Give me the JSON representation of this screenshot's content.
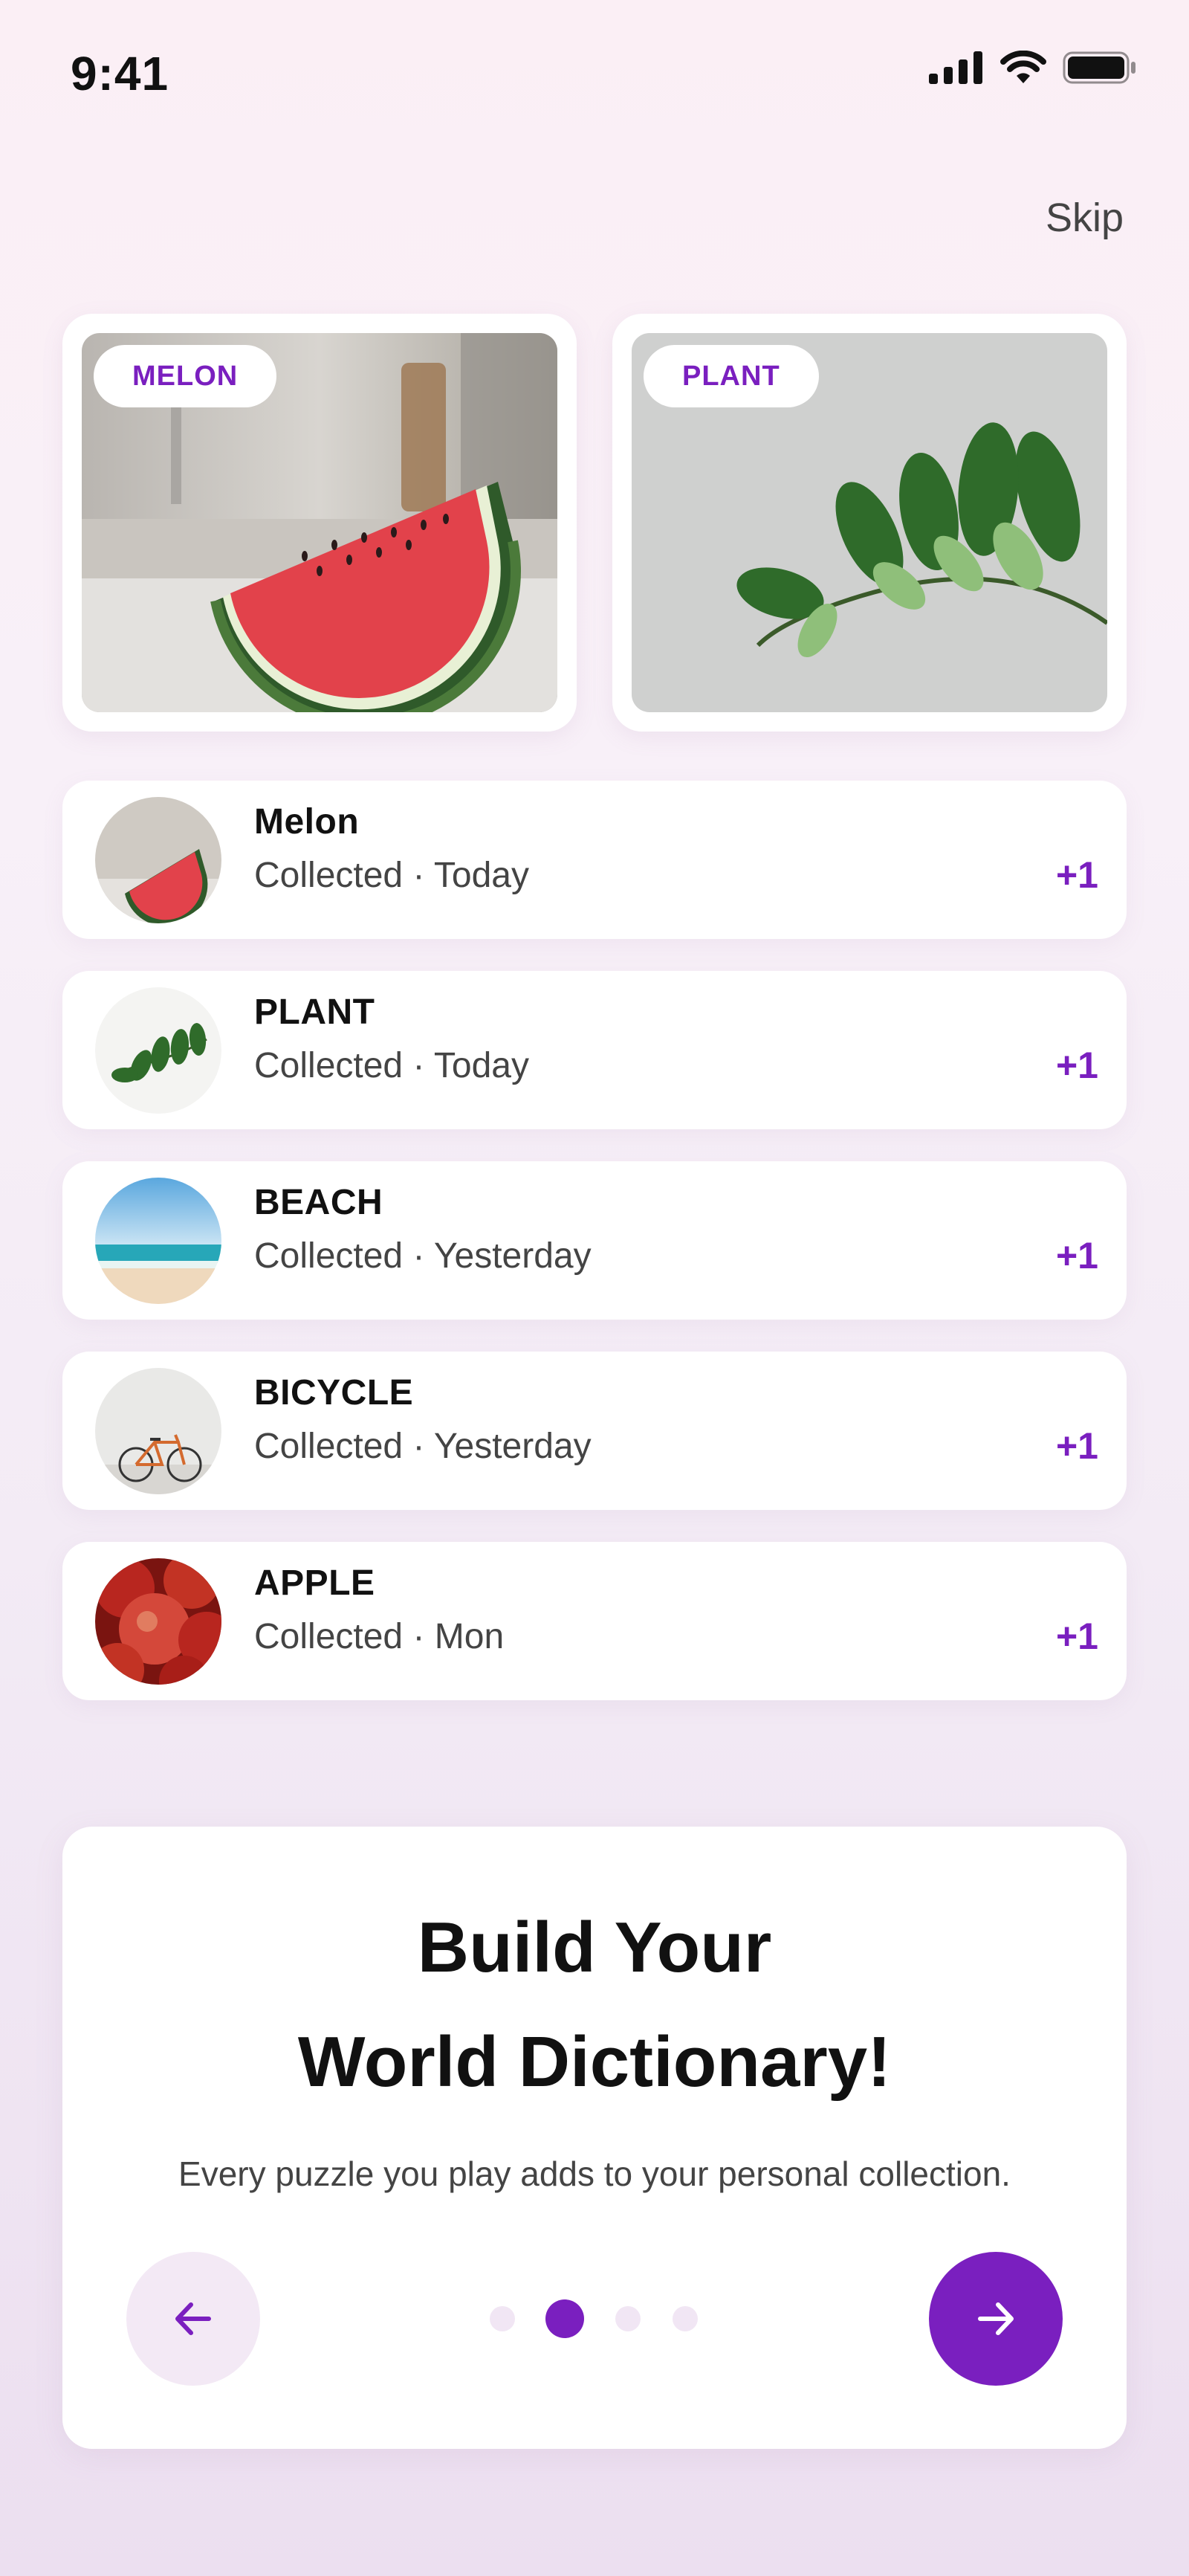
{
  "status_bar": {
    "time": "9:41"
  },
  "header": {
    "skip_label": "Skip"
  },
  "hero_cards": [
    {
      "tag": "MELON"
    },
    {
      "tag": "PLANT"
    }
  ],
  "collection": [
    {
      "title": "Melon",
      "subtitle": "Collected · Today",
      "points": "+1"
    },
    {
      "title": "PLANT",
      "subtitle": "Collected · Today",
      "points": "+1"
    },
    {
      "title": "BEACH",
      "subtitle": "Collected · Yesterday",
      "points": "+1"
    },
    {
      "title": "BICYCLE",
      "subtitle": "Collected · Yesterday",
      "points": "+1"
    },
    {
      "title": "APPLE",
      "subtitle": "Collected · Mon",
      "points": "+1"
    }
  ],
  "onboarding": {
    "headline_line1": "Build Your",
    "headline_line2": "World Dictionary!",
    "description": "Every puzzle you play adds to your personal collection.",
    "page_count": 4,
    "current_page": 2
  },
  "colors": {
    "accent": "#7a1fbf",
    "dot_inactive": "#f1e6f4"
  }
}
